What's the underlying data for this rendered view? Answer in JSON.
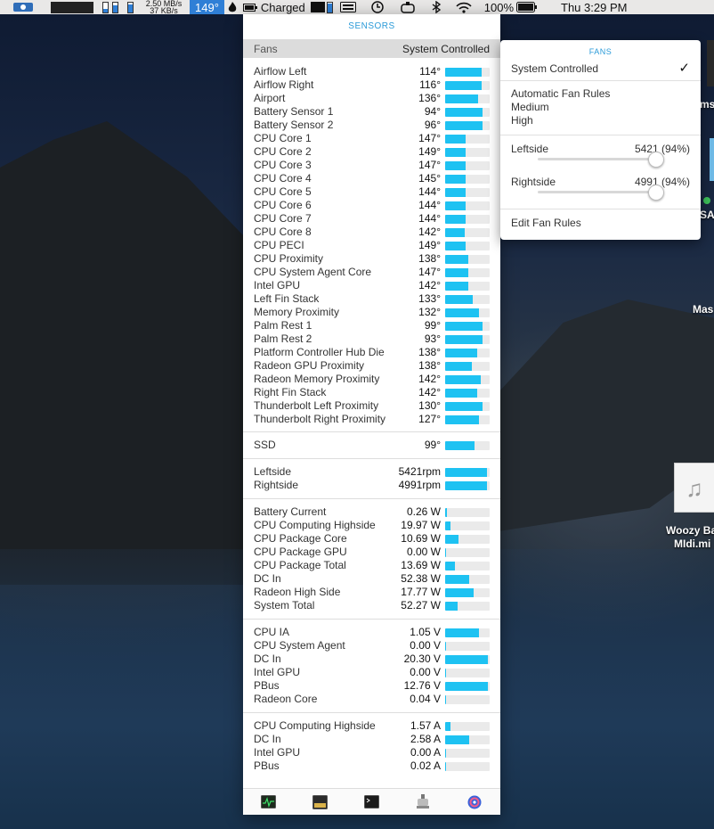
{
  "menubar": {
    "net_up": "2.50 MB/s",
    "net_down": "37 KB/s",
    "temp": "149°",
    "battery_status": "Charged",
    "battery_percent": "100%",
    "clock": "Thu 3:29 PM"
  },
  "panel": {
    "title": "SENSORS",
    "fans_label": "Fans",
    "fans_mode": "System Controlled",
    "temperatures": [
      {
        "label": "Airflow Left",
        "value": "114°",
        "level": 0.82
      },
      {
        "label": "Airflow Right",
        "value": "116°",
        "level": 0.82
      },
      {
        "label": "Airport",
        "value": "136°",
        "level": 0.74
      },
      {
        "label": "Battery Sensor 1",
        "value": "94°",
        "level": 0.84
      },
      {
        "label": "Battery Sensor 2",
        "value": "96°",
        "level": 0.84
      },
      {
        "label": "CPU Core 1",
        "value": "147°",
        "level": 0.46
      },
      {
        "label": "CPU Core 2",
        "value": "149°",
        "level": 0.46
      },
      {
        "label": "CPU Core 3",
        "value": "147°",
        "level": 0.46
      },
      {
        "label": "CPU Core 4",
        "value": "145°",
        "level": 0.46
      },
      {
        "label": "CPU Core 5",
        "value": "144°",
        "level": 0.46
      },
      {
        "label": "CPU Core 6",
        "value": "144°",
        "level": 0.46
      },
      {
        "label": "CPU Core 7",
        "value": "144°",
        "level": 0.46
      },
      {
        "label": "CPU Core 8",
        "value": "142°",
        "level": 0.44
      },
      {
        "label": "CPU PECI",
        "value": "149°",
        "level": 0.46
      },
      {
        "label": "CPU Proximity",
        "value": "138°",
        "level": 0.52
      },
      {
        "label": "CPU System Agent Core",
        "value": "147°",
        "level": 0.52
      },
      {
        "label": "Intel GPU",
        "value": "142°",
        "level": 0.52
      },
      {
        "label": "Left Fin Stack",
        "value": "133°",
        "level": 0.62
      },
      {
        "label": "Memory Proximity",
        "value": "132°",
        "level": 0.76
      },
      {
        "label": "Palm Rest 1",
        "value": "99°",
        "level": 0.84
      },
      {
        "label": "Palm Rest 2",
        "value": "93°",
        "level": 0.84
      },
      {
        "label": "Platform Controller Hub Die",
        "value": "138°",
        "level": 0.72
      },
      {
        "label": "Radeon GPU Proximity",
        "value": "138°",
        "level": 0.6
      },
      {
        "label": "Radeon Memory Proximity",
        "value": "142°",
        "level": 0.8
      },
      {
        "label": "Right Fin Stack",
        "value": "142°",
        "level": 0.72
      },
      {
        "label": "Thunderbolt Left Proximity",
        "value": "130°",
        "level": 0.84
      },
      {
        "label": "Thunderbolt Right Proximity",
        "value": "127°",
        "level": 0.76
      }
    ],
    "ssd": [
      {
        "label": "SSD",
        "value": "99°",
        "level": 0.66
      }
    ],
    "fans": [
      {
        "label": "Leftside",
        "value": "5421rpm",
        "level": 0.94
      },
      {
        "label": "Rightside",
        "value": "4991rpm",
        "level": 0.94
      }
    ],
    "power": [
      {
        "label": "Battery Current",
        "value": "0.26 W",
        "level": 0.03
      },
      {
        "label": "CPU Computing Highside",
        "value": "19.97 W",
        "level": 0.12
      },
      {
        "label": "CPU Package Core",
        "value": "10.69 W",
        "level": 0.3
      },
      {
        "label": "CPU Package GPU",
        "value": "0.00 W",
        "level": 0.01
      },
      {
        "label": "CPU Package Total",
        "value": "13.69 W",
        "level": 0.22
      },
      {
        "label": "DC In",
        "value": "52.38 W",
        "level": 0.54
      },
      {
        "label": "Radeon High Side",
        "value": "17.77 W",
        "level": 0.64
      },
      {
        "label": "System Total",
        "value": "52.27 W",
        "level": 0.28
      }
    ],
    "voltage": [
      {
        "label": "CPU IA",
        "value": "1.05 V",
        "level": 0.76
      },
      {
        "label": "CPU System Agent",
        "value": "0.00 V",
        "level": 0.01
      },
      {
        "label": "DC In",
        "value": "20.30 V",
        "level": 0.96
      },
      {
        "label": "Intel GPU",
        "value": "0.00 V",
        "level": 0.01
      },
      {
        "label": "PBus",
        "value": "12.76 V",
        "level": 0.96
      },
      {
        "label": "Radeon Core",
        "value": "0.04 V",
        "level": 0.02
      }
    ],
    "current": [
      {
        "label": "CPU Computing Highside",
        "value": "1.57 A",
        "level": 0.12
      },
      {
        "label": "DC In",
        "value": "2.58 A",
        "level": 0.54
      },
      {
        "label": "Intel GPU",
        "value": "0.00 A",
        "level": 0.01
      },
      {
        "label": "PBus",
        "value": "0.02 A",
        "level": 0.02
      }
    ],
    "footer_icons": [
      "activity-monitor-icon",
      "console-icon",
      "terminal-icon",
      "system-info-icon",
      "istat-menus-icon"
    ]
  },
  "fan_popup": {
    "title": "FANS",
    "mode": "System Controlled",
    "checkmark": "✓",
    "rules_header": "Automatic Fan Rules",
    "rules": [
      "Medium",
      "High"
    ],
    "fans": [
      {
        "label": "Leftside",
        "value": "5421 (94%)",
        "level": 0.94
      },
      {
        "label": "Rightside",
        "value": "4991 (94%)",
        "level": 0.94
      }
    ],
    "edit_label": "Edit Fan Rules"
  },
  "desktop": {
    "label_ms": "ms",
    "label_sa": "SA",
    "label_mas": "Mas",
    "file_label_1": "Woozy Ba",
    "file_label_2": "MIdi.mi"
  },
  "colors": {
    "accent": "#1ec2f2",
    "title_blue": "#2a9ad8",
    "menubar": "#e9e8e7"
  }
}
